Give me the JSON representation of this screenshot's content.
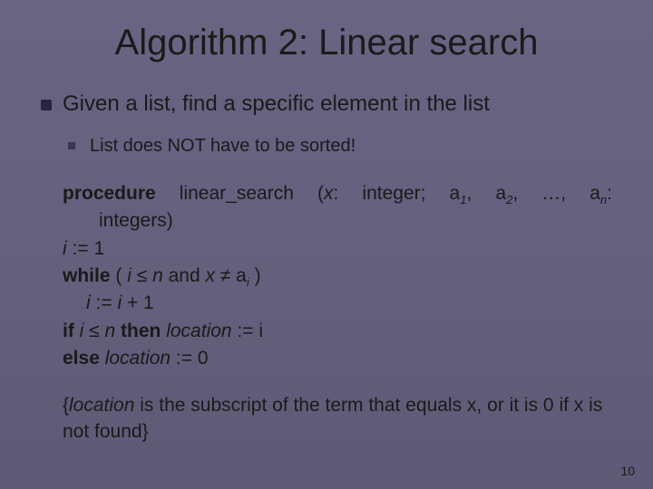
{
  "title": "Algorithm 2: Linear search",
  "bullet_main": "Given a list, find a specific element in the list",
  "sub_bullet": "List does NOT have to be sorted!",
  "code": {
    "proc_kw": "procedure",
    "proc_rest": "  linear_search  (",
    "proc_x": "x",
    "proc_int1": ":  integer;  a",
    "proc_comma": ",  a",
    "proc_dots": ",  …,  a",
    "proc_end": ":",
    "proc_cont": "integers)",
    "init_i": "i",
    "init_rest": " := 1",
    "while_kw": "while",
    "while_open": " ( ",
    "while_i": "i",
    "while_le": " ≤ ",
    "while_n": "n",
    "while_and": " and ",
    "while_x": "x",
    "while_ne": " ≠ a",
    "while_close": " )",
    "inc_i": "i",
    "inc_rest": " := ",
    "inc_i2": "i",
    "inc_plus": " + 1",
    "if_kw": "if",
    "if_i": " i",
    "if_le": " ≤ ",
    "if_n": "n ",
    "then_kw": "then",
    "then_loc": " location",
    "then_rest": " := i",
    "else_kw": "else",
    "else_loc": " location",
    "else_rest": " := 0",
    "sub1": "1",
    "sub2": "2",
    "subn": "n",
    "subi": "i"
  },
  "footer_open": "{",
  "footer_loc": "location",
  "footer_rest": " is the subscript of the term that equals x, or it is 0 if x is not found}",
  "page_num": "10"
}
